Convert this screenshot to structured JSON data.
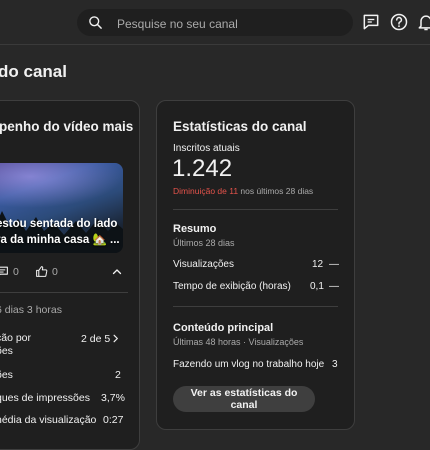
{
  "header": {
    "search_placeholder": "Pesquise no seu canal"
  },
  "page": {
    "title": "do canal"
  },
  "left_card": {
    "title": "penho do vídeo mais",
    "video_title_line1": "estou sentada do lado",
    "video_title_line2": "ra da minha casa 🏡 ...",
    "comments": "0",
    "likes": "0",
    "time_label": "6 dias 3 horas",
    "rows": [
      {
        "label_line1": "ção por",
        "label_line2": "ões",
        "value": "2 de 5"
      },
      {
        "label_line1": "ões",
        "label_line2": "",
        "value": "2"
      },
      {
        "label_line1": "ques de impressões",
        "label_line2": "",
        "value": "3,7%"
      },
      {
        "label_line1": "nédia da visualização",
        "label_line2": "",
        "value": "0:27"
      }
    ]
  },
  "right_card": {
    "title": "Estatísticas do canal",
    "subscribers_label": "Inscritos atuais",
    "subscribers_value": "1.242",
    "change_text": "Diminuição de 11",
    "change_period": "nos últimos 28 dias",
    "summary_title": "Resumo",
    "summary_period": "Últimos 28 dias",
    "summary_rows": [
      {
        "label": "Visualizações",
        "value": "12",
        "trend": "—"
      },
      {
        "label": "Tempo de exibição (horas)",
        "value": "0,1",
        "trend": "—"
      }
    ],
    "top_content_title": "Conteúdo principal",
    "top_content_period": "Últimas 48 horas · Visualizações",
    "top_content_rows": [
      {
        "label": "Fazendo um vlog no trabalho hoje",
        "value": "3"
      }
    ],
    "cta_label": "Ver as estatísticas do canal"
  },
  "colors": {
    "background": "#282828",
    "card": "#1f1f1f",
    "negative": "#e5534b"
  }
}
